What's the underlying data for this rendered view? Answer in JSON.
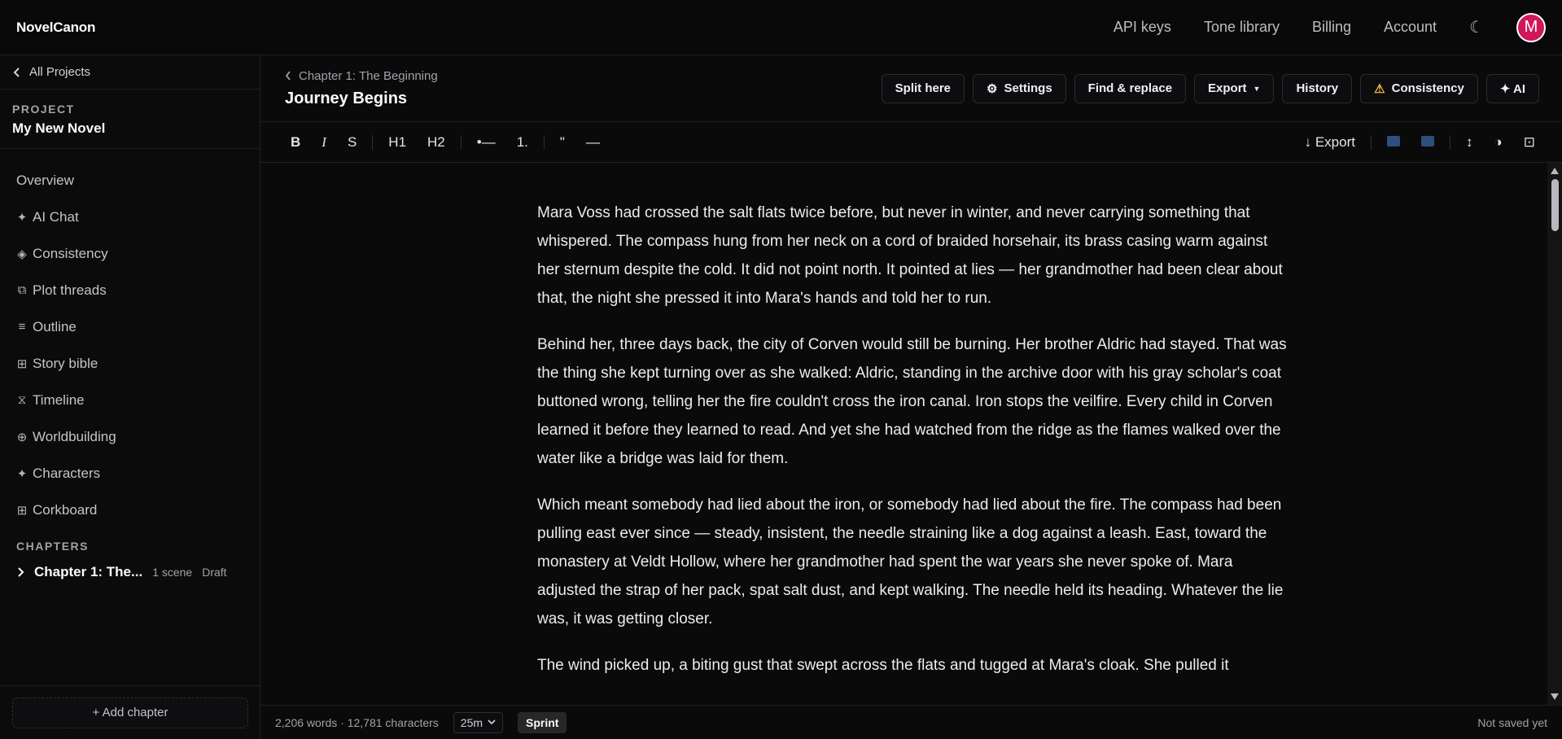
{
  "app": {
    "brand": "NovelCanon"
  },
  "topnav": {
    "links": [
      "API keys",
      "Tone library",
      "Billing",
      "Account"
    ],
    "theme_glyph": "☾",
    "avatar_initial": "M"
  },
  "sidebar": {
    "back_label": "All Projects",
    "project_caption": "PROJECT",
    "project_name": "My New Novel",
    "nav": [
      {
        "glyph": "",
        "label": "Overview",
        "icon": "none"
      },
      {
        "glyph": "✦",
        "label": "AI Chat",
        "icon": "sparkle-icon"
      },
      {
        "glyph": "◈",
        "label": "Consistency",
        "icon": "diamond-icon"
      },
      {
        "glyph": "⧉",
        "label": "Plot threads",
        "icon": "threads-icon"
      },
      {
        "glyph": "≡",
        "label": "Outline",
        "icon": "list-icon"
      },
      {
        "glyph": "⊞",
        "label": "Story bible",
        "icon": "grid-icon"
      },
      {
        "glyph": "⧖",
        "label": "Timeline",
        "icon": "hourglass-icon"
      },
      {
        "glyph": "⊕",
        "label": "Worldbuilding",
        "icon": "globe-icon"
      },
      {
        "glyph": "✦",
        "label": "Characters",
        "icon": "sparkle-icon"
      },
      {
        "glyph": "⊞",
        "label": "Corkboard",
        "icon": "grid-icon"
      }
    ],
    "chapters_caption": "CHAPTERS",
    "chapters": [
      {
        "title": "Chapter 1: The...",
        "scenes": "1 scene",
        "status": "Draft"
      }
    ],
    "add_chapter_label": "+ Add chapter"
  },
  "doc": {
    "breadcrumb": "Chapter 1: The Beginning",
    "title": "Journey Begins",
    "actions": {
      "split": "Split here",
      "settings": "Settings",
      "find_replace": "Find & replace",
      "export": "Export",
      "history": "History",
      "consistency": "Consistency",
      "ai": "✦ AI"
    }
  },
  "toolbar": {
    "bold": "B",
    "italic": "I",
    "strike": "S",
    "h1": "H1",
    "h2": "H2",
    "bullet": "•—",
    "ordered": "1.",
    "quote": "\"",
    "rule": "—",
    "export": "↓ Export",
    "line_height_glyph": "↕",
    "contrast_glyph": "◑",
    "focus_glyph": "⊡"
  },
  "editor": {
    "paragraphs": [
      "Mara Voss had crossed the salt flats twice before, but never in winter, and never carrying something that whispered. The compass hung from her neck on a cord of braided horsehair, its brass casing warm against her sternum despite the cold. It did not point north. It pointed at lies — her grandmother had been clear about that, the night she pressed it into Mara's hands and told her to run.",
      "Behind her, three days back, the city of Corven would still be burning. Her brother Aldric had stayed. That was the thing she kept turning over as she walked: Aldric, standing in the archive door with his gray scholar's coat buttoned wrong, telling her the fire couldn't cross the iron canal. Iron stops the veilfire. Every child in Corven learned it before they learned to read. And yet she had watched from the ridge as the flames walked over the water like a bridge was laid for them.",
      "Which meant somebody had lied about the iron, or somebody had lied about the fire. The compass had been pulling east ever since — steady, insistent, the needle straining like a dog against a leash. East, toward the monastery at Veldt Hollow, where her grandmother had spent the war years she never spoke of. Mara adjusted the strap of her pack, spat salt dust, and kept walking. The needle held its heading. Whatever the lie was, it was getting closer.",
      "The wind picked up, a biting gust that swept across the flats and tugged at Mara's cloak. She pulled it"
    ]
  },
  "status": {
    "counts": "2,206 words · 12,781 characters",
    "timer_value": "25m",
    "sprint_label": "Sprint",
    "save_state": "Not saved yet"
  }
}
